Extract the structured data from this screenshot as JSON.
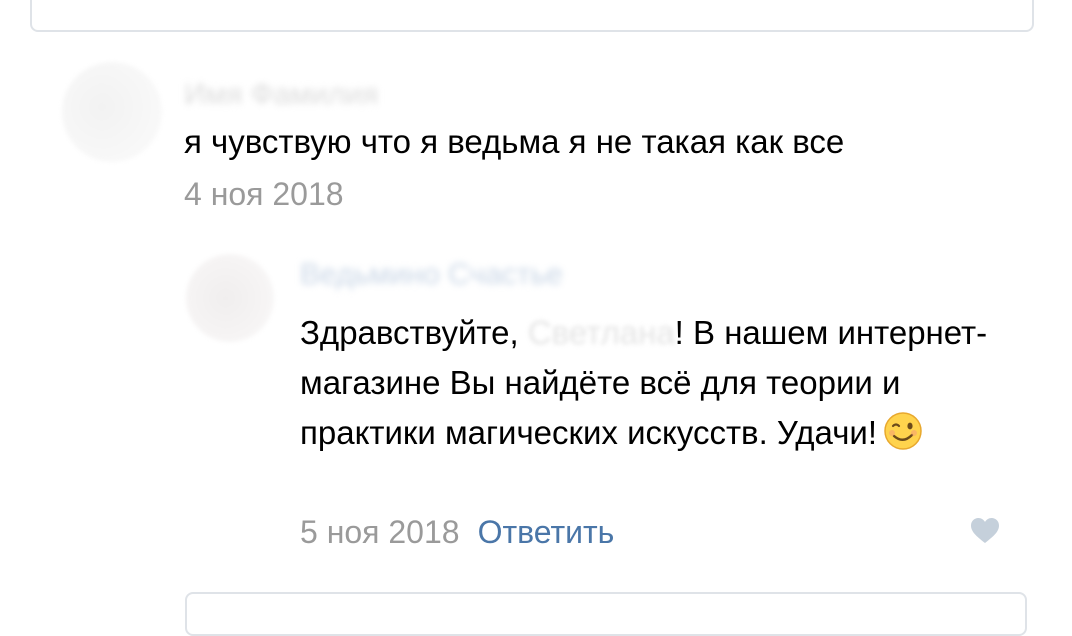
{
  "comment": {
    "author_name": "Имя Фамилия",
    "text": "я чувствую что я ведьма я не такая как все",
    "date": "4 ноя 2018"
  },
  "reply": {
    "author_name": "Ведьмино Счастье",
    "text_before": "Здравствуйте, ",
    "addressee": "Светлана",
    "text_after": "! В нашем интернет-магазине Вы найдёте всё для теории и практики магических искусств. Удачи!",
    "emoji": "winking-face-icon",
    "date": "5 ноя 2018",
    "reply_label": "Ответить",
    "like_icon": "heart-icon"
  },
  "colors": {
    "text": "#000000",
    "muted": "#9a9a9a",
    "link": "#4a76a8",
    "border": "#dfe3e8",
    "like": "#c5d0db"
  }
}
